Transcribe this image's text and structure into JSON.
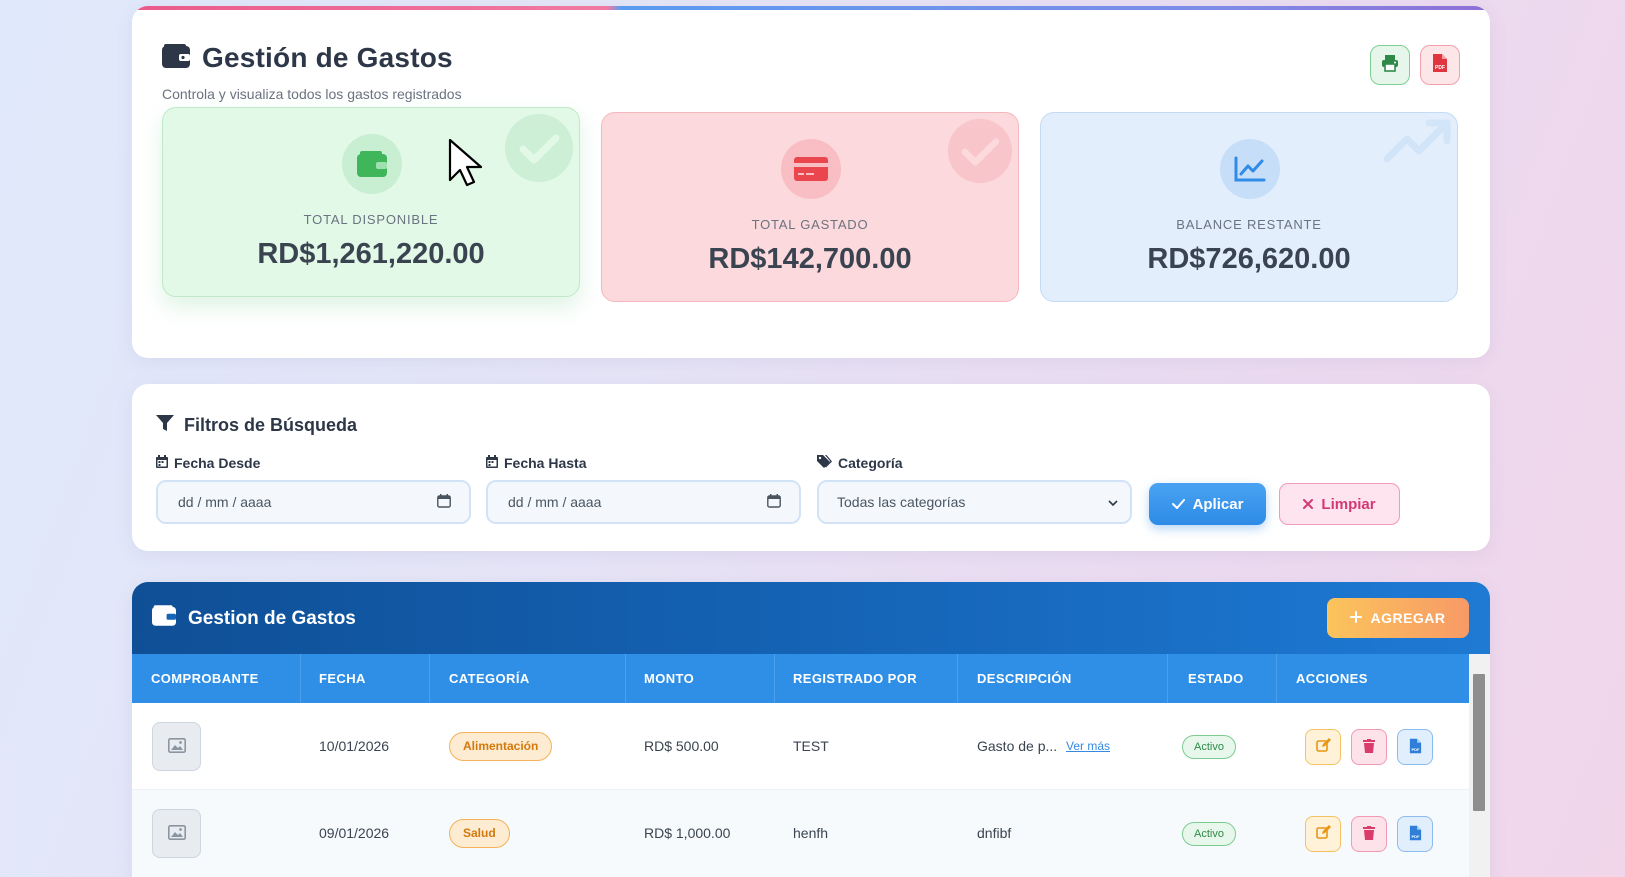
{
  "header": {
    "title": "Gestión de Gastos",
    "subtitle": "Controla y visualiza todos los gastos registrados",
    "print_icon": "print-icon",
    "pdf_icon": "file-pdf-icon"
  },
  "stats": [
    {
      "label": "TOTAL DISPONIBLE",
      "value": "RD$1,261,220.00",
      "icon": "wallet-icon",
      "color": "#3fb65a"
    },
    {
      "label": "TOTAL GASTADO",
      "value": "RD$142,700.00",
      "icon": "credit-card-icon",
      "color": "#e9464e"
    },
    {
      "label": "BALANCE RESTANTE",
      "value": "RD$726,620.00",
      "icon": "chart-line-icon",
      "color": "#2f8be6"
    }
  ],
  "filters": {
    "title": "Filtros de Búsqueda",
    "date_from_label": "Fecha Desde",
    "date_from_placeholder": "dd / mm / aaaa",
    "date_to_label": "Fecha Hasta",
    "date_to_placeholder": "dd / mm / aaaa",
    "category_label": "Categoría",
    "category_selected": "Todas las categorías",
    "apply_label": "Aplicar",
    "clear_label": "Limpiar"
  },
  "table": {
    "title": "Gestion de Gastos",
    "add_label": "AGREGAR",
    "columns": [
      "COMPROBANTE",
      "FECHA",
      "CATEGORÍA",
      "MONTO",
      "REGISTRADO POR",
      "DESCRIPCIÓN",
      "ESTADO",
      "ACCIONES"
    ],
    "rows": [
      {
        "date": "10/01/2026",
        "category": "Alimentación",
        "amount": "RD$ 500.00",
        "registered_by": "TEST",
        "description": "Gasto de p...",
        "more": "Ver más",
        "status": "Activo"
      },
      {
        "date": "09/01/2026",
        "category": "Salud",
        "amount": "RD$ 1,000.00",
        "registered_by": "henfh",
        "description": "dnfibf",
        "more": "",
        "status": "Activo"
      }
    ]
  },
  "colors": {
    "primary": "#2f8fe6",
    "header_dark": "#0f4f96",
    "accent_orange": "#f7a85f",
    "danger_pink": "#d23a75"
  }
}
